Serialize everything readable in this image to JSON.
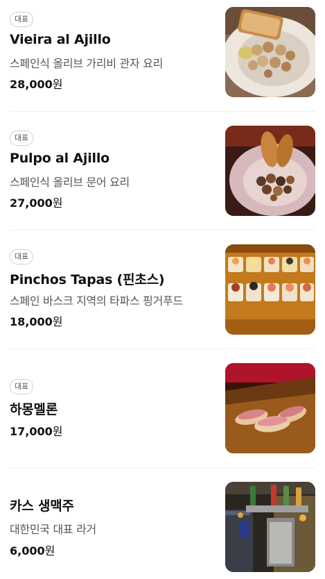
{
  "menu": {
    "items": [
      {
        "badge": "대표",
        "name": "Vieira al Ajillo",
        "description": "스페인식 올리브 가리비 관자 요리",
        "price": "28,000",
        "unit": "원",
        "photo": "scallop-ajillo-photo"
      },
      {
        "badge": "대표",
        "name": "Pulpo al Ajillo",
        "description": "스페인식 올리브 문어 요리",
        "price": "27,000",
        "unit": "원",
        "photo": "octopus-ajillo-photo"
      },
      {
        "badge": "대표",
        "name": "Pinchos Tapas (핀초스)",
        "description": "스페인 바스크 지역의 타파스 핑거푸드",
        "price": "18,000",
        "unit": "원",
        "photo": "pinchos-tapas-photo"
      },
      {
        "badge": "대표",
        "name": "하몽멜론",
        "description": "",
        "price": "17,000",
        "unit": "원",
        "photo": "jamon-melon-photo"
      },
      {
        "badge": "",
        "name": "카스 생맥주",
        "description": "대한민국 대표 라거",
        "price": "6,000",
        "unit": "원",
        "photo": "draft-beer-tap-photo"
      }
    ]
  }
}
